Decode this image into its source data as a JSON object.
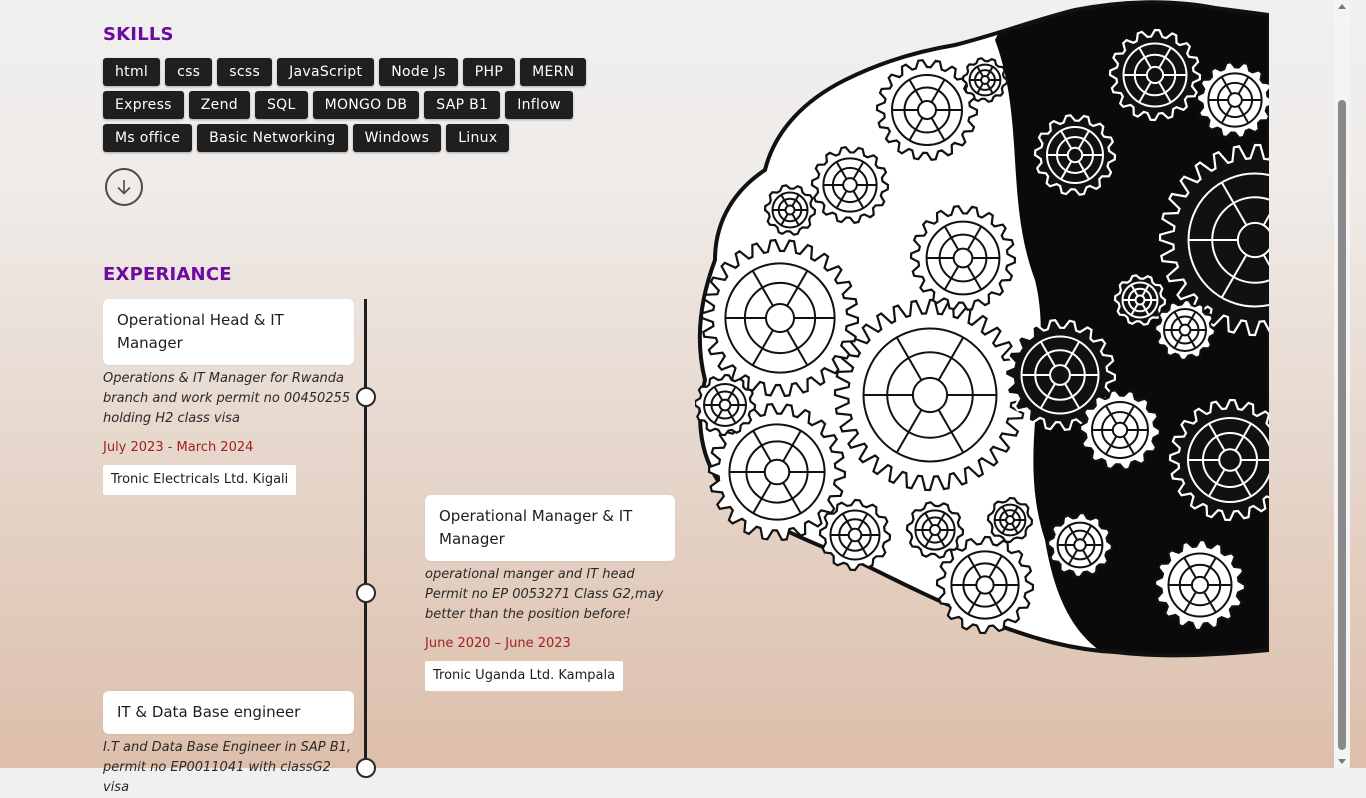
{
  "skills": {
    "title": "SKILLS",
    "items": [
      "html",
      "css",
      "scss",
      "JavaScript",
      "Node Js",
      "PHP",
      "MERN",
      "Express",
      "Zend",
      "SQL",
      "MONGO DB",
      "SAP B1",
      "Inflow",
      "Ms office",
      "Basic Networking",
      "Windows",
      "Linux"
    ]
  },
  "experience": {
    "title": "EXPERIANCE",
    "jobs": [
      {
        "title": "Operational Head & IT Manager",
        "description": "Operations & IT Manager for Rwanda branch and work permit no 00450255 holding H2 class visa",
        "dates": "July 2023 - March 2024",
        "company": "Tronic Electricals Ltd. Kigali"
      },
      {
        "title": "Operational Manager & IT Manager",
        "description": "operational manger and IT head Permit no EP 0053271 Class G2,may better than the position before!",
        "dates": "June 2020 – June 2023",
        "company": "Tronic Uganda Ltd. Kampala"
      },
      {
        "title": "IT & Data Base engineer",
        "description": "I.T and Data Base Engineer in SAP B1, permit no EP0011041 with classG2 visa"
      }
    ]
  },
  "icons": {
    "scroll_down": "arrow-down-circle-icon",
    "illustration": "gear-brain-illustration"
  },
  "colors": {
    "section_title": "#6d0aa0",
    "date_text": "#a32020",
    "skill_bg": "#1f1f1f"
  }
}
